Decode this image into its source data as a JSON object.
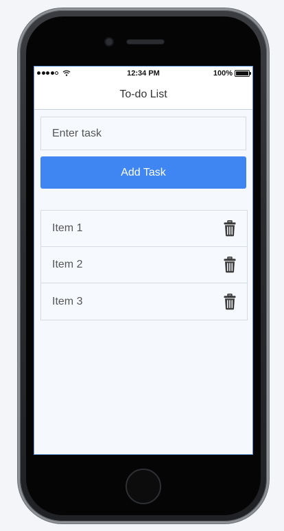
{
  "status_bar": {
    "time": "12:34 PM",
    "battery": "100%",
    "signal_icon": "signal-dots-icon",
    "wifi_icon": "wifi-icon",
    "battery_icon": "battery-icon"
  },
  "nav": {
    "title": "To-do List"
  },
  "task_form": {
    "input_value": "",
    "input_placeholder": "Enter task",
    "add_button_label": "Add Task"
  },
  "tasks": [
    {
      "label": "Item 1",
      "delete_icon": "trash-icon"
    },
    {
      "label": "Item 2",
      "delete_icon": "trash-icon"
    },
    {
      "label": "Item 3",
      "delete_icon": "trash-icon"
    }
  ],
  "colors": {
    "accent": "#3f86f2",
    "screen_background": "#f5f8fc",
    "border": "#d6dbe2",
    "text": "#555555"
  }
}
